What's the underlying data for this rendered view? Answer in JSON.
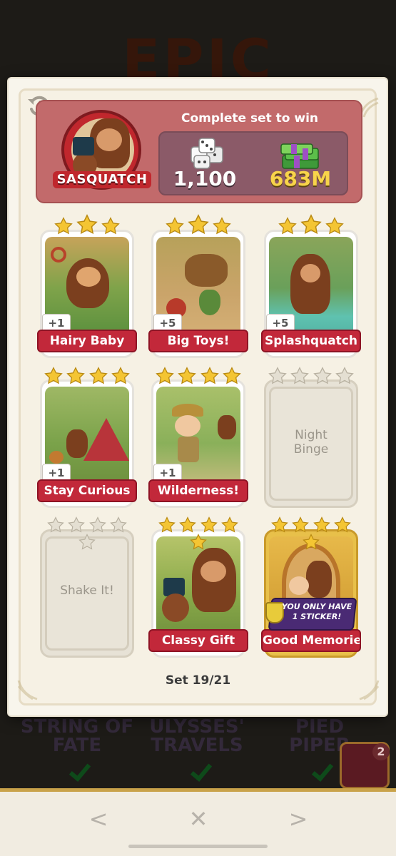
{
  "background": {
    "title": "EPIC",
    "sets": [
      "STRING OF FATE",
      "ULYSSES' TRAVELS",
      "PIED PIPER"
    ],
    "badge_count": "2"
  },
  "header": {
    "set_name": "SASQUATCH",
    "reward_title": "Complete set to win",
    "dice_reward": "1,100",
    "cash_reward": "683M"
  },
  "cards": [
    {
      "name": "Hairy Baby",
      "stars": 3,
      "count": "+1",
      "collected": true
    },
    {
      "name": "Big Toys!",
      "stars": 3,
      "count": "+5",
      "collected": true
    },
    {
      "name": "Splashquatch",
      "stars": 3,
      "count": "+5",
      "collected": true
    },
    {
      "name": "Stay Curious",
      "stars": 4,
      "count": "+1",
      "collected": true
    },
    {
      "name": "Wilderness!",
      "stars": 4,
      "count": "+1",
      "collected": true
    },
    {
      "name": "Night Binge",
      "stars": 4,
      "count": "",
      "collected": false
    },
    {
      "name": "Shake It!",
      "stars": 5,
      "count": "",
      "collected": false
    },
    {
      "name": "Classy Gift",
      "stars": 5,
      "count": "",
      "collected": true
    },
    {
      "name": "Good Memories",
      "stars": 5,
      "count": "",
      "collected": true
    }
  ],
  "sticker_notice": "YOU ONLY HAVE 1 STICKER!",
  "set_progress": "Set 19/21",
  "nav": {
    "prev": "<",
    "close": "✕",
    "next": ">"
  },
  "colors": {
    "star": "#f4c533",
    "label_red": "#c2283a",
    "banner": "#c26a6b",
    "cash": "#f8d44a"
  }
}
